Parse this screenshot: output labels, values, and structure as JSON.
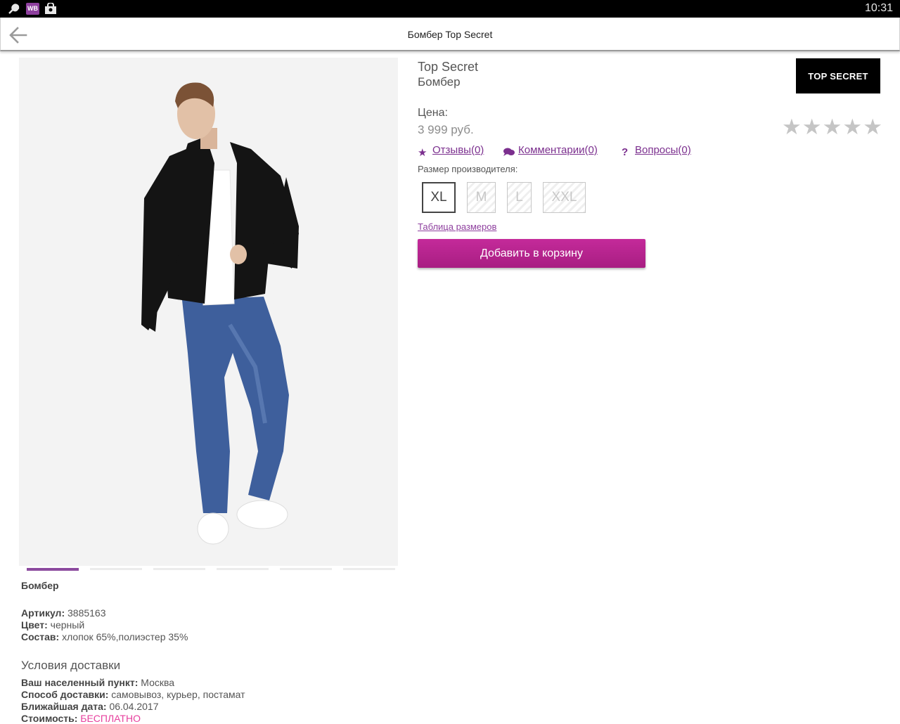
{
  "status_bar": {
    "badge": "WB",
    "time": "10:31",
    "icons": [
      "wrench-icon",
      "wb-app-icon",
      "shopping-bag-icon"
    ]
  },
  "toolbar": {
    "title": "Бомбер Top Secret",
    "back_icon": "arrow-left-icon"
  },
  "gallery": {
    "image_count": 6,
    "active_index": 0
  },
  "product": {
    "brand": "Top Secret",
    "name": "Бомбер",
    "brand_logo_text": "TOP SECRET",
    "price_label": "Цена:",
    "price": "3 999 руб.",
    "rating_stars": 5,
    "rating_value": 0
  },
  "links": {
    "reviews": "Отзывы(0)",
    "comments": "Комментарии(0)",
    "questions": "Вопросы(0)"
  },
  "sizes": {
    "label": "Размер производителя:",
    "options": [
      {
        "label": "XL",
        "available": true,
        "selected": true
      },
      {
        "label": "M",
        "available": false,
        "selected": false
      },
      {
        "label": "L",
        "available": false,
        "selected": false
      },
      {
        "label": "XXL",
        "available": false,
        "selected": false
      }
    ],
    "table_link": "Таблица размеров"
  },
  "cart_button": "Добавить в корзину",
  "details": {
    "name": "Бомбер",
    "article_label": "Артикул:",
    "article": "3885163",
    "color_label": "Цвет:",
    "color": "черный",
    "composition_label": "Состав:",
    "composition": "хлопок 65%,полиэстер 35%"
  },
  "delivery": {
    "title": "Условия доставки",
    "city_label": "Ваш населенный пункт:",
    "city": "Москва",
    "method_label": "Способ доставки:",
    "method": "самовывоз, курьер, постамат",
    "date_label": "Ближайшая дата:",
    "date": "06.04.2017",
    "cost_label": "Стоимость:",
    "cost": "БЕСПЛАТНО"
  },
  "colors": {
    "accent": "#8e3f9e",
    "button": "#b5228c",
    "free": "#e7409e"
  }
}
